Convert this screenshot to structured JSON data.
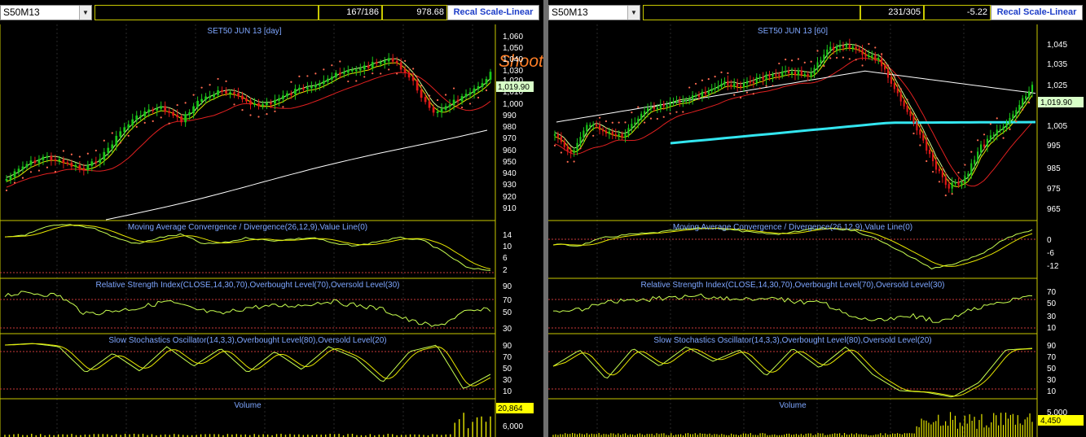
{
  "left": {
    "symbol": "S50M13",
    "counter": "167/186",
    "value": "978.68",
    "recal_label": "Recal Scale-Linear",
    "price_title": "SET50 JUN 13   [day]",
    "annotation": "Shooting Star",
    "price_axis": [
      "1,060",
      "1,050",
      "1,040",
      "1,030",
      "1,020",
      "1,010",
      "1,000",
      "990",
      "980",
      "970",
      "960",
      "950",
      "940",
      "930",
      "920",
      "910"
    ],
    "last_price": "1,019.90",
    "macd_title": "Moving Average Convergence / Divergence(26,12,9),Value Line(0)",
    "macd_axis": [
      "14",
      "10",
      "6",
      "2"
    ],
    "rsi_title": "Relative Strength Index(CLOSE,14,30,70),Overbought Level(70),Oversold Level(30)",
    "rsi_axis": [
      "90",
      "70",
      "50",
      "30"
    ],
    "stoch_title": "Slow Stochastics Oscillator(14,3,3),Overbought Level(80),Oversold Level(20)",
    "stoch_axis": [
      "90",
      "70",
      "50",
      "30",
      "10"
    ],
    "volume_title": "Volume",
    "volume_axis": [
      "6,000"
    ],
    "last_volume": "20,864"
  },
  "right": {
    "symbol": "S50M13",
    "counter": "231/305",
    "value": "-5.22",
    "recal_label": "Recal Scale-Linear",
    "price_title": "SET50 JUN 13   [60]",
    "price_axis": [
      "1,045",
      "1,035",
      "1,025",
      "1,005",
      "995",
      "985",
      "975",
      "965"
    ],
    "last_price": "1,019.90",
    "macd_title": "Moving Average Convergence / Divergence(26,12,9),Value Line(0)",
    "macd_axis": [
      "0",
      "-6",
      "-12"
    ],
    "rsi_title": "Relative Strength Index(CLOSE,14,30,70),Overbought Level(70),Oversold Level(30)",
    "rsi_axis": [
      "70",
      "50",
      "30",
      "10"
    ],
    "stoch_title": "Slow Stochastics Oscillator(14,3,3),Overbought Level(80),Oversold Level(20)",
    "stoch_axis": [
      "90",
      "70",
      "50",
      "30",
      "10"
    ],
    "volume_title": "Volume",
    "volume_axis": [
      "5,000"
    ],
    "last_volume": "4,450"
  },
  "colors": {
    "bull": "#19c819",
    "bear": "#e01818",
    "ma_fast": "#e8e800",
    "ma_mid": "#e02020",
    "ma_slow": "#ffffff",
    "cyan": "#33e6f0",
    "sar": "#ff6a50",
    "panel_border": "#c8c800",
    "label": "#7ea6ff",
    "osc": "#c8ff50",
    "signal": "#e8e800",
    "level": "#c83a3a",
    "volume": "#e8e800",
    "annotation": "#ff7f27"
  }
}
